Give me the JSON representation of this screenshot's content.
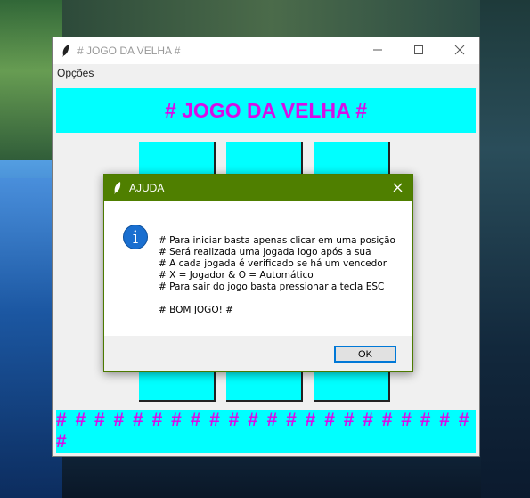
{
  "window": {
    "title": "# JOGO DA VELHA #",
    "menu": [
      "Opções"
    ],
    "header": "# JOGO DA VELHA #",
    "footer": "# # # # # # # # # # # # # # # # # # # # # # #"
  },
  "dialog": {
    "title": "AJUDA",
    "lines": [
      "# Para iniciar basta apenas clicar em uma posição",
      "# Será realizada uma jogada logo após a sua",
      "# A cada jogada é verificado se há um vencedor",
      "# X = Jogador & O = Automático",
      "# Para sair do jogo basta pressionar a tecla ESC",
      "# BOM JOGO! #"
    ],
    "ok_label": "OK"
  },
  "colors": {
    "cell": "#00ffff",
    "banner_text": "#d60ee8",
    "dialog_titlebar": "#4f7f00"
  },
  "icons": [
    "feather-icon",
    "minimize-icon",
    "maximize-icon",
    "close-icon",
    "info-icon"
  ]
}
